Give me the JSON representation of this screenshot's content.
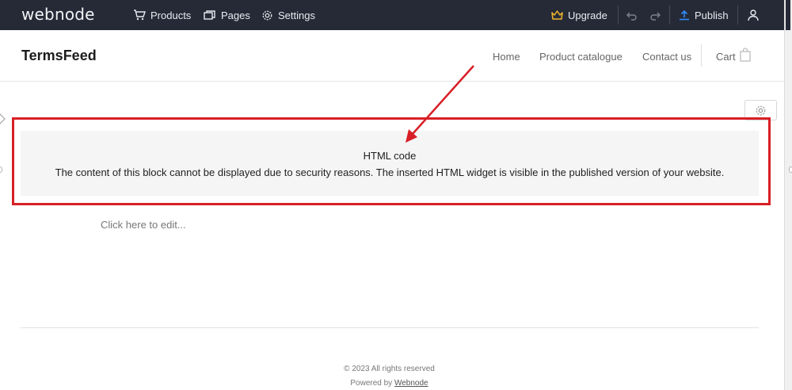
{
  "editor": {
    "logo": "webnode",
    "menu": {
      "products": "Products",
      "pages": "Pages",
      "settings": "Settings"
    },
    "upgrade": "Upgrade",
    "publish": "Publish",
    "icons": [
      "cart-icon",
      "pages-icon",
      "gear-icon",
      "crown-icon",
      "undo-icon",
      "redo-icon",
      "upload-icon",
      "user-icon"
    ],
    "colors": {
      "bar": "#262a37",
      "upgrade_icon": "#f2b52b",
      "publish_icon": "#2f8cff"
    }
  },
  "site": {
    "brand": "TermsFeed",
    "nav": {
      "home": "Home",
      "catalogue": "Product catalogue",
      "contact": "Contact us",
      "cart": "Cart"
    }
  },
  "html_block": {
    "title": "HTML code",
    "description": "The content of this block cannot be displayed due to security reasons. The inserted HTML widget is visible in the published version of your website."
  },
  "text_block": {
    "placeholder": "Click here to edit..."
  },
  "annotation": {
    "color": "#d81f26"
  },
  "footer": {
    "copyright": "© 2023 All rights reserved",
    "powered_prefix": "Powered by",
    "powered_link": "Webnode"
  }
}
